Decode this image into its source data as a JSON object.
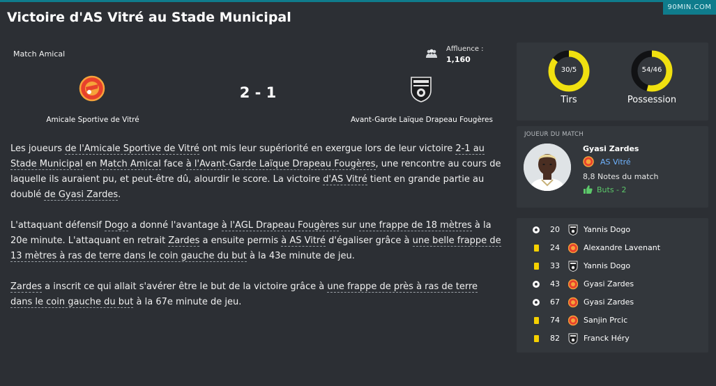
{
  "brand": "90MIN.COM",
  "page_title": "Victoire d'AS Vitré au Stade Municipal",
  "match": {
    "competition": "Match Amical",
    "attendance_label": "Affluence :",
    "attendance_value": "1,160",
    "score": "2 - 1",
    "home_team": "Amicale Sportive de Vitré",
    "away_team": "Avant-Garde Laïque Drapeau Fougères"
  },
  "report": {
    "p1": [
      {
        "t": "Les joueurs ",
        "u": false
      },
      {
        "t": "de l'Amicale Sportive de Vitré",
        "u": true
      },
      {
        "t": " ont mis leur supériorité en exergue lors de leur victoire ",
        "u": false
      },
      {
        "t": "2-1 au Stade Municipal",
        "u": true
      },
      {
        "t": " en ",
        "u": false
      },
      {
        "t": "Match Amical",
        "u": true
      },
      {
        "t": " face ",
        "u": false
      },
      {
        "t": "à l'Avant-Garde Laïque Drapeau Fougères",
        "u": true
      },
      {
        "t": ", une rencontre au cours de laquelle ils auraient pu, et peut-être dû, alourdir le score. La victoire ",
        "u": false
      },
      {
        "t": "d'AS Vitré",
        "u": true
      },
      {
        "t": " tient en grande partie au doublé ",
        "u": false
      },
      {
        "t": "de Gyasi Zardes",
        "u": true
      },
      {
        "t": ".",
        "u": false
      }
    ],
    "p2": [
      {
        "t": "L'attaquant défensif ",
        "u": false
      },
      {
        "t": "Dogo",
        "u": true
      },
      {
        "t": " a donné l'avantage ",
        "u": false
      },
      {
        "t": "à l'AGL Drapeau Fougères",
        "u": true
      },
      {
        "t": " sur ",
        "u": false
      },
      {
        "t": "une frappe de 18 mètres",
        "u": true
      },
      {
        "t": " à la 20e minute. L'attaquant en retrait ",
        "u": false
      },
      {
        "t": "Zardes",
        "u": true
      },
      {
        "t": " a ensuite permis ",
        "u": false
      },
      {
        "t": "à AS Vitré",
        "u": true
      },
      {
        "t": " d'égaliser grâce à ",
        "u": false
      },
      {
        "t": "une belle frappe de 13 mètres à ras de terre dans le coin gauche du but",
        "u": true
      },
      {
        "t": " à la 43e minute de jeu.",
        "u": false
      }
    ],
    "p3": [
      {
        "t": "Zardes",
        "u": true
      },
      {
        "t": " a inscrit ce qui allait s'avérer être le but de la victoire grâce à ",
        "u": false
      },
      {
        "t": "une frappe de près à ras de terre dans le coin gauche du but",
        "u": true
      },
      {
        "t": " à la 67e minute de jeu.",
        "u": false
      }
    ]
  },
  "stats": {
    "shots": {
      "label": "Tirs",
      "value": "30/5",
      "home_share": 0.857
    },
    "possession": {
      "label": "Possession",
      "value": "54/46",
      "home_share": 0.54
    }
  },
  "player_of_match": {
    "heading": "JOUEUR DU MATCH",
    "name": "Gyasi Zardes",
    "club": "AS Vitré",
    "rating": "8,8 Notes du match",
    "goals": "Buts - 2"
  },
  "events": [
    {
      "type": "goal",
      "minute": "20",
      "team": "away",
      "player": "Yannis Dogo"
    },
    {
      "type": "yellow",
      "minute": "24",
      "team": "home",
      "player": "Alexandre Lavenant"
    },
    {
      "type": "yellow",
      "minute": "33",
      "team": "away",
      "player": "Yannis Dogo"
    },
    {
      "type": "goal",
      "minute": "43",
      "team": "home",
      "player": "Gyasi Zardes"
    },
    {
      "type": "goal",
      "minute": "67",
      "team": "home",
      "player": "Gyasi Zardes"
    },
    {
      "type": "yellow",
      "minute": "74",
      "team": "home",
      "player": "Sanjin Prcic"
    },
    {
      "type": "yellow",
      "minute": "82",
      "team": "away",
      "player": "Franck Héry"
    }
  ],
  "colors": {
    "background": "#2c2f34",
    "panel": "#33373c",
    "accent": "#0f7c8c",
    "stat_ring": "#f0e010",
    "link": "#6fb3ff",
    "positive": "#5cc86a"
  },
  "icons": {
    "attendance": "crowd-icon",
    "goal": "football-icon",
    "yellow": "yellow-card-icon",
    "thumb": "thumbs-up-icon"
  }
}
